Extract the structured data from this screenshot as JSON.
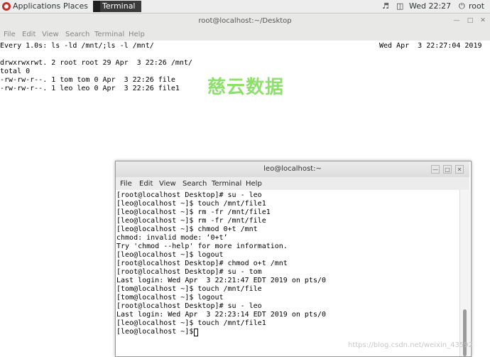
{
  "topbar": {
    "applications": "Applications",
    "places": "Places",
    "taskbar_terminal": "Terminal",
    "clock": "Wed 22:27",
    "user": "root"
  },
  "back_window": {
    "title": "root@localhost:~/Desktop",
    "menu": [
      "File",
      "Edit",
      "View",
      "Search",
      "Terminal",
      "Help"
    ],
    "watch_header": "Every 1.0s: ls -ld /mnt/;ls -l /mnt/",
    "watch_time": "Wed Apr  3 22:27:04 2019",
    "lines": [
      "drwxrwxrwt. 2 root root 29 Apr  3 22:26 /mnt/",
      "total 0",
      "-rw-rw-r--. 1 tom tom 0 Apr  3 22:26 file",
      "-rw-rw-r--. 1 leo leo 0 Apr  3 22:26 file1"
    ]
  },
  "watermark": "慈云数据",
  "front_window": {
    "title": "leo@localhost:~",
    "menu": [
      "File",
      "Edit",
      "View",
      "Search",
      "Terminal",
      "Help"
    ],
    "lines": [
      "[root@localhost Desktop]# su - leo",
      "[leo@localhost ~]$ touch /mnt/file1",
      "[leo@localhost ~]$ rm -fr /mnt/file1",
      "[leo@localhost ~]$ rm -fr /mnt/file",
      "[leo@localhost ~]$ chmod 0+t /mnt",
      "chmod: invalid mode: ‘0+t’",
      "Try 'chmod --help' for more information.",
      "[leo@localhost ~]$ logout",
      "[root@localhost Desktop]# chmod o+t /mnt",
      "[root@localhost Desktop]# su - tom",
      "Last login: Wed Apr  3 22:21:47 EDT 2019 on pts/0",
      "[tom@localhost ~]$ touch /mnt/file",
      "[tom@localhost ~]$ logout",
      "[root@localhost Desktop]# su - leo",
      "Last login: Wed Apr  3 22:23:14 EDT 2019 on pts/0",
      "[leo@localhost ~]$ touch /mnt/file1",
      "[leo@localhost ~]$ "
    ]
  },
  "source_url": "https://blog.csdn.net/weixin_43592"
}
